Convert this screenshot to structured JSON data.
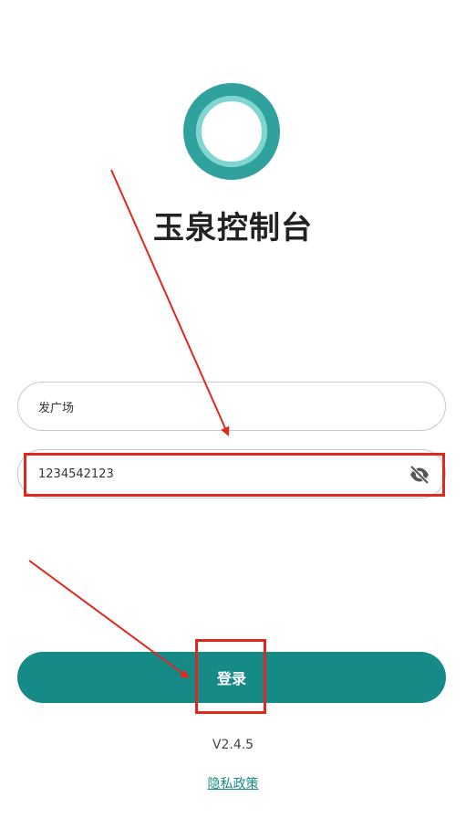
{
  "app": {
    "title": "玉泉控制台",
    "logo_icon": "ring-logo-icon"
  },
  "form": {
    "username_value": "发广场",
    "password_value": "1234542123",
    "password_visibility_icon": "eye-off-icon"
  },
  "actions": {
    "login_label": "登录"
  },
  "footer": {
    "version": "V2.4.5",
    "privacy_link": "隐私政策"
  },
  "colors": {
    "brand": "#168a86",
    "logo_outer": "#2fa29d",
    "logo_inner": "#7fd6d0",
    "annotation": "#e0281e"
  }
}
